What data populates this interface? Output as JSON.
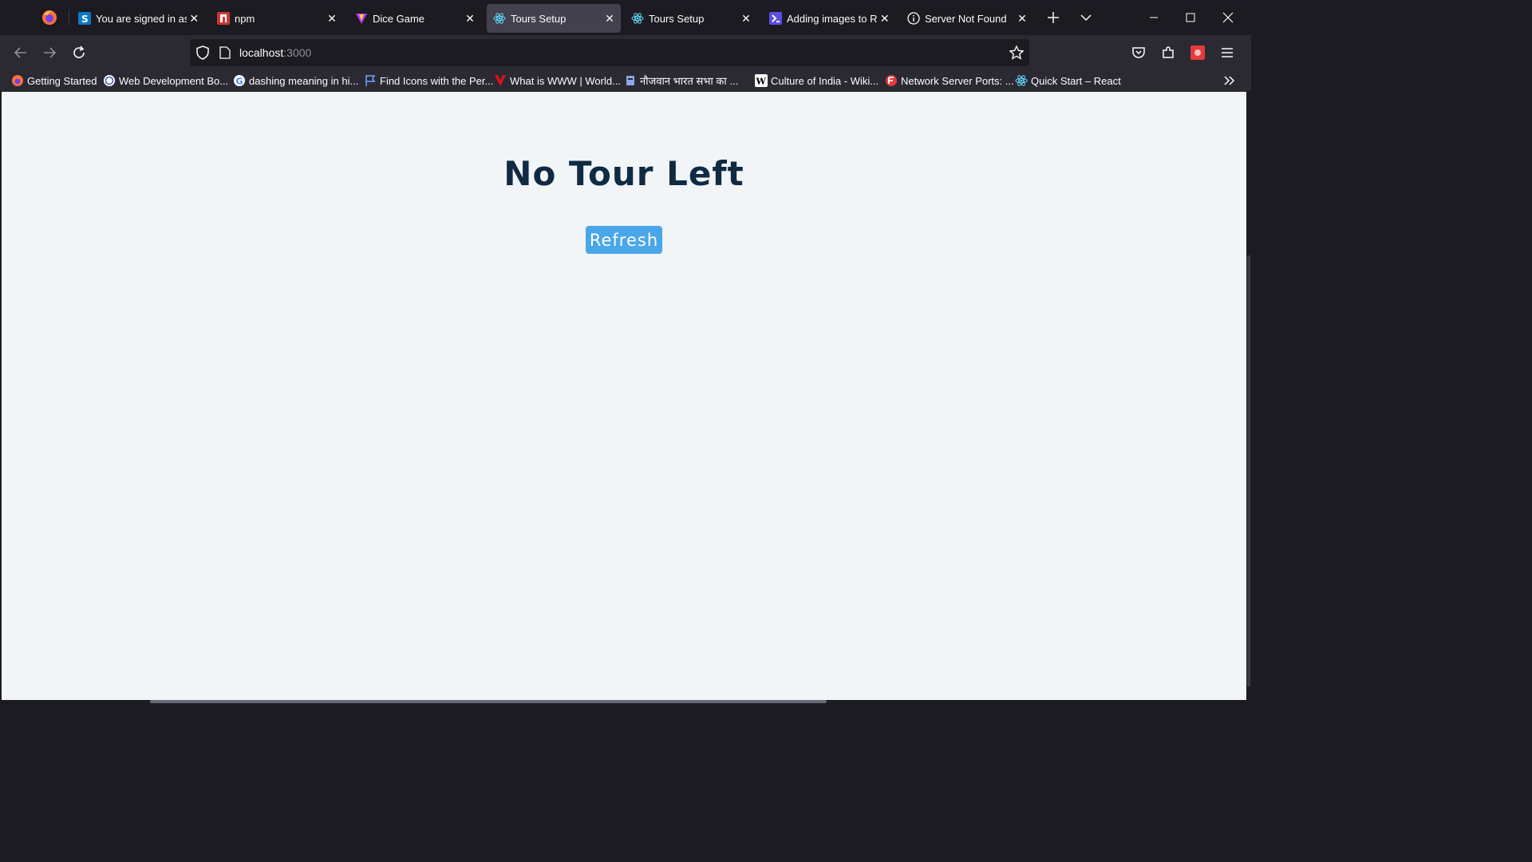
{
  "browser": {
    "tabs": [
      {
        "title": "You are signed in as S",
        "icon": "s-app-icon",
        "color": "#0e7ac4"
      },
      {
        "title": "npm",
        "icon": "npm-icon",
        "color": "#cb3837"
      },
      {
        "title": "Dice Game",
        "icon": "vite-icon",
        "color": "#bd34fe"
      },
      {
        "title": "Tours Setup",
        "icon": "react-icon",
        "color": "#61dafb"
      },
      {
        "title": "Tours Setup",
        "icon": "react-icon",
        "color": "#61dafb"
      },
      {
        "title": "Adding images to RE",
        "icon": "terminal-icon",
        "color": "#5c4ee5"
      },
      {
        "title": "Server Not Found",
        "icon": "info-icon",
        "color": "#fbfbfe"
      }
    ],
    "active_tab": 3,
    "url": {
      "host": "localhost",
      "port": ":3000"
    },
    "bookmarks": [
      {
        "label": "Getting Started",
        "icon": "firefox-icon"
      },
      {
        "label": "Web Development Bo...",
        "icon": "webdev-icon"
      },
      {
        "label": "dashing meaning in hi...",
        "icon": "google-icon"
      },
      {
        "label": "Find Icons with the Per...",
        "icon": "flag-icon"
      },
      {
        "label": "What is WWW | World...",
        "icon": "v-icon"
      },
      {
        "label": "नौजवान भारत सभा का ...",
        "icon": "emblem-icon"
      },
      {
        "label": "Culture of India - Wiki...",
        "icon": "wikipedia-icon"
      },
      {
        "label": "Network Server Ports: ...",
        "icon": "f-icon"
      },
      {
        "label": "Quick Start – React",
        "icon": "react-icon"
      }
    ]
  },
  "page": {
    "heading": "No Tour Left",
    "refresh_label": "Refresh",
    "background": "#f1f5f8",
    "heading_color": "#102a42",
    "button_color": "#49a6e9"
  }
}
